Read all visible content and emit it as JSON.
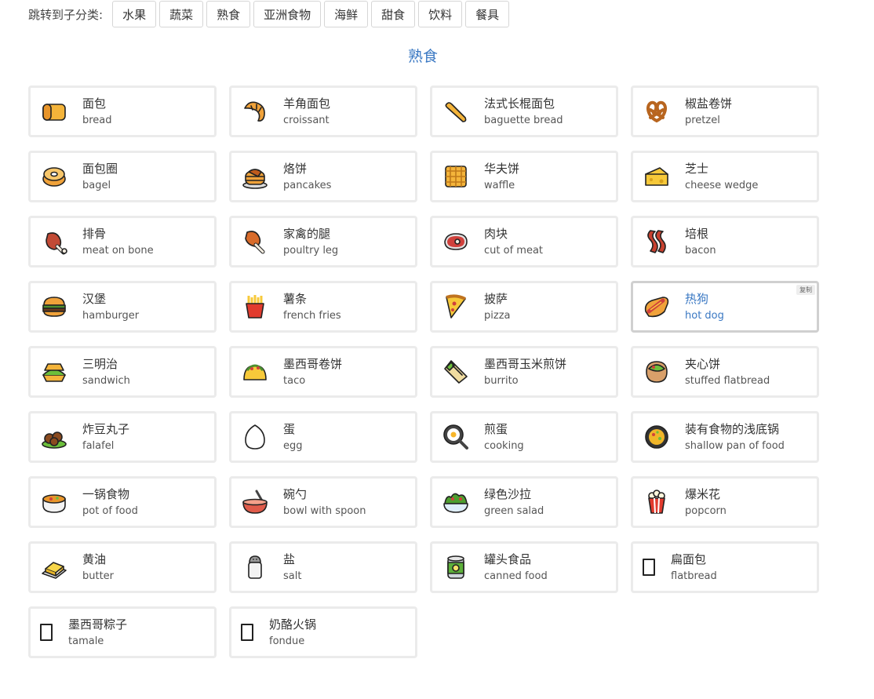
{
  "subnav": {
    "label": "跳转到子分类:",
    "items": [
      "水果",
      "蔬菜",
      "熟食",
      "亚洲食物",
      "海鲜",
      "甜食",
      "饮料",
      "餐具"
    ]
  },
  "section": {
    "title": "熟食"
  },
  "copy_label": "复制",
  "foods": [
    {
      "zh": "面包",
      "en": "bread",
      "icon": "bread-icon"
    },
    {
      "zh": "羊角面包",
      "en": "croissant",
      "icon": "croissant-icon"
    },
    {
      "zh": "法式长棍面包",
      "en": "baguette bread",
      "icon": "baguette-icon"
    },
    {
      "zh": "椒盐卷饼",
      "en": "pretzel",
      "icon": "pretzel-icon"
    },
    {
      "zh": "面包圈",
      "en": "bagel",
      "icon": "bagel-icon"
    },
    {
      "zh": "烙饼",
      "en": "pancakes",
      "icon": "pancakes-icon"
    },
    {
      "zh": "华夫饼",
      "en": "waffle",
      "icon": "waffle-icon"
    },
    {
      "zh": "芝士",
      "en": "cheese wedge",
      "icon": "cheese-icon"
    },
    {
      "zh": "排骨",
      "en": "meat on bone",
      "icon": "meat-on-bone-icon"
    },
    {
      "zh": "家禽的腿",
      "en": "poultry leg",
      "icon": "poultry-leg-icon"
    },
    {
      "zh": "肉块",
      "en": "cut of meat",
      "icon": "cut-of-meat-icon"
    },
    {
      "zh": "培根",
      "en": "bacon",
      "icon": "bacon-icon"
    },
    {
      "zh": "汉堡",
      "en": "hamburger",
      "icon": "hamburger-icon"
    },
    {
      "zh": "薯条",
      "en": "french fries",
      "icon": "french-fries-icon"
    },
    {
      "zh": "披萨",
      "en": "pizza",
      "icon": "pizza-icon"
    },
    {
      "zh": "热狗",
      "en": "hot dog",
      "icon": "hot-dog-icon"
    },
    {
      "zh": "三明治",
      "en": "sandwich",
      "icon": "sandwich-icon"
    },
    {
      "zh": "墨西哥卷饼",
      "en": "taco",
      "icon": "taco-icon"
    },
    {
      "zh": "墨西哥玉米煎饼",
      "en": "burrito",
      "icon": "burrito-icon"
    },
    {
      "zh": "夹心饼",
      "en": "stuffed flatbread",
      "icon": "stuffed-flatbread-icon"
    },
    {
      "zh": "炸豆丸子",
      "en": "falafel",
      "icon": "falafel-icon"
    },
    {
      "zh": "蛋",
      "en": "egg",
      "icon": "egg-icon"
    },
    {
      "zh": "煎蛋",
      "en": "cooking",
      "icon": "frying-pan-egg-icon"
    },
    {
      "zh": "装有食物的浅底锅",
      "en": "shallow pan of food",
      "icon": "paella-icon"
    },
    {
      "zh": "一锅食物",
      "en": "pot of food",
      "icon": "pot-of-food-icon"
    },
    {
      "zh": "碗勺",
      "en": "bowl with spoon",
      "icon": "bowl-with-spoon-icon"
    },
    {
      "zh": "绿色沙拉",
      "en": "green salad",
      "icon": "green-salad-icon"
    },
    {
      "zh": "爆米花",
      "en": "popcorn",
      "icon": "popcorn-icon"
    },
    {
      "zh": "黄油",
      "en": "butter",
      "icon": "butter-icon"
    },
    {
      "zh": "盐",
      "en": "salt",
      "icon": "salt-icon"
    },
    {
      "zh": "罐头食品",
      "en": "canned food",
      "icon": "canned-food-icon"
    },
    {
      "zh": "扁面包",
      "en": "flatbread",
      "icon": "missing-glyph-icon"
    },
    {
      "zh": "墨西哥粽子",
      "en": "tamale",
      "icon": "missing-glyph-icon"
    },
    {
      "zh": "奶酪火锅",
      "en": "fondue",
      "icon": "missing-glyph-icon"
    }
  ],
  "active_index": 15,
  "colors": {
    "accent": "#3a78c3",
    "card_border": "#ebebeb"
  }
}
